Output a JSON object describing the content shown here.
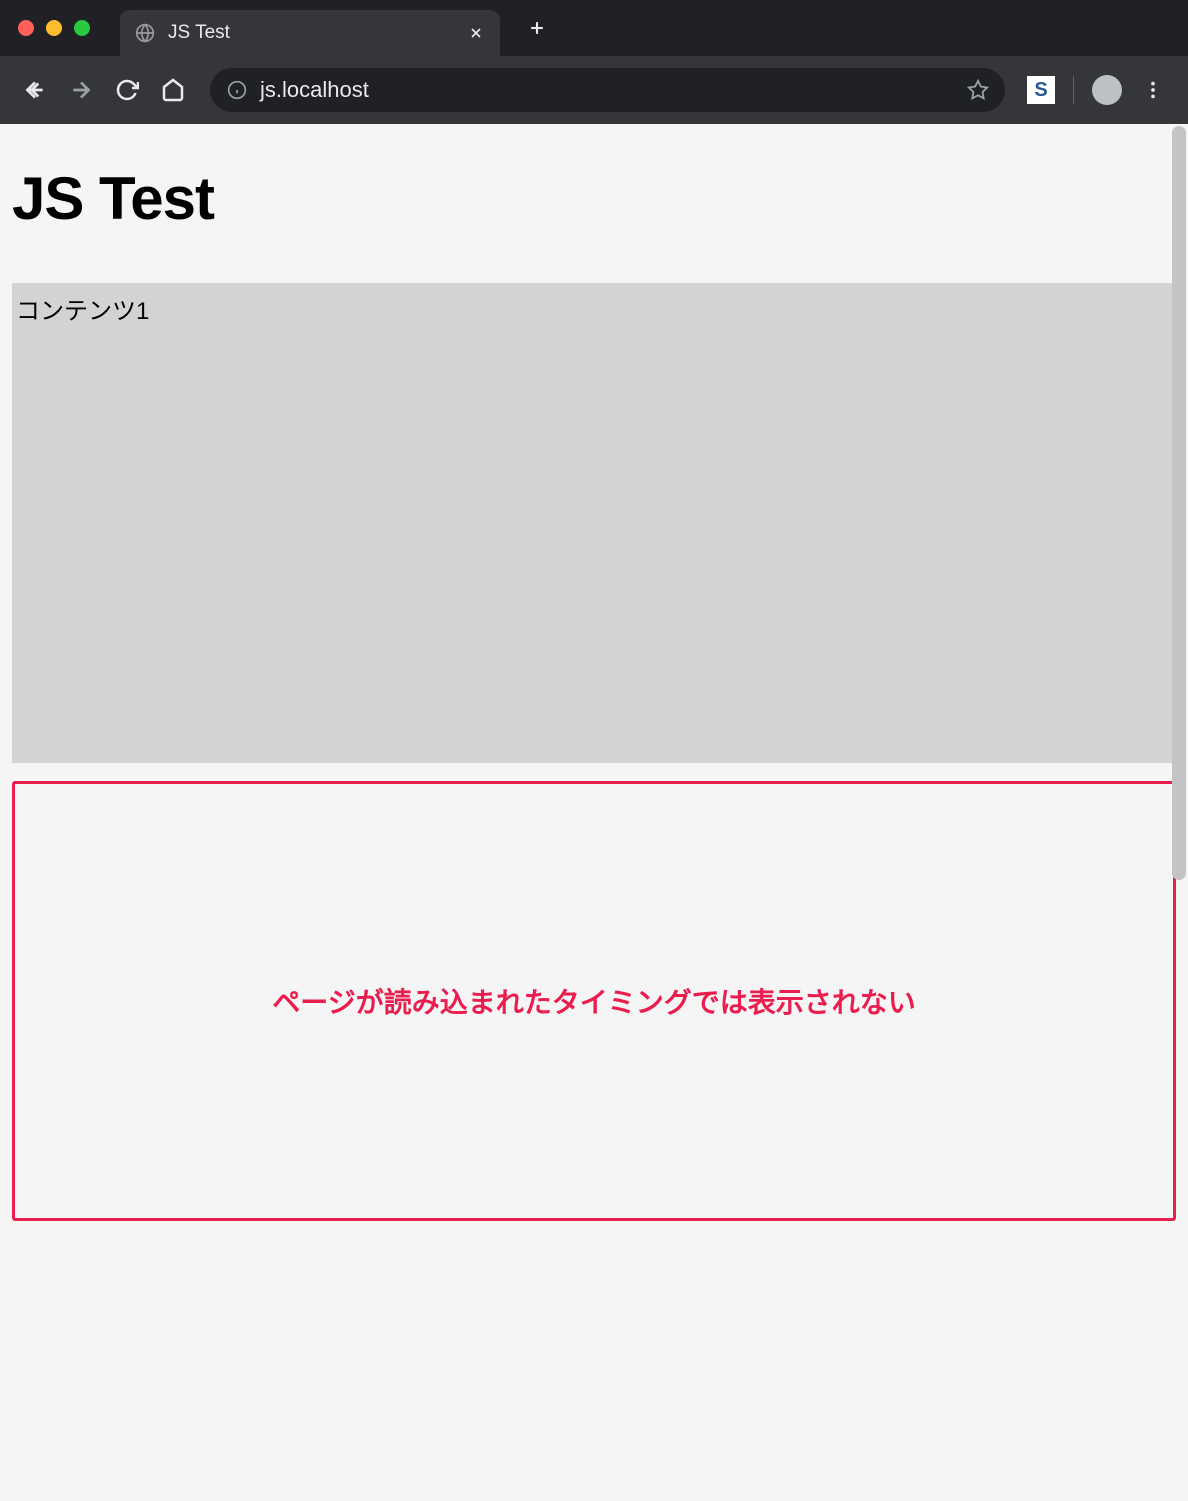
{
  "browser": {
    "tab": {
      "title": "JS Test"
    },
    "url": "js.localhost"
  },
  "page": {
    "heading": "JS Test",
    "content1": "コンテンツ1",
    "content2": "ページが読み込まれたタイミングでは表示されない"
  }
}
